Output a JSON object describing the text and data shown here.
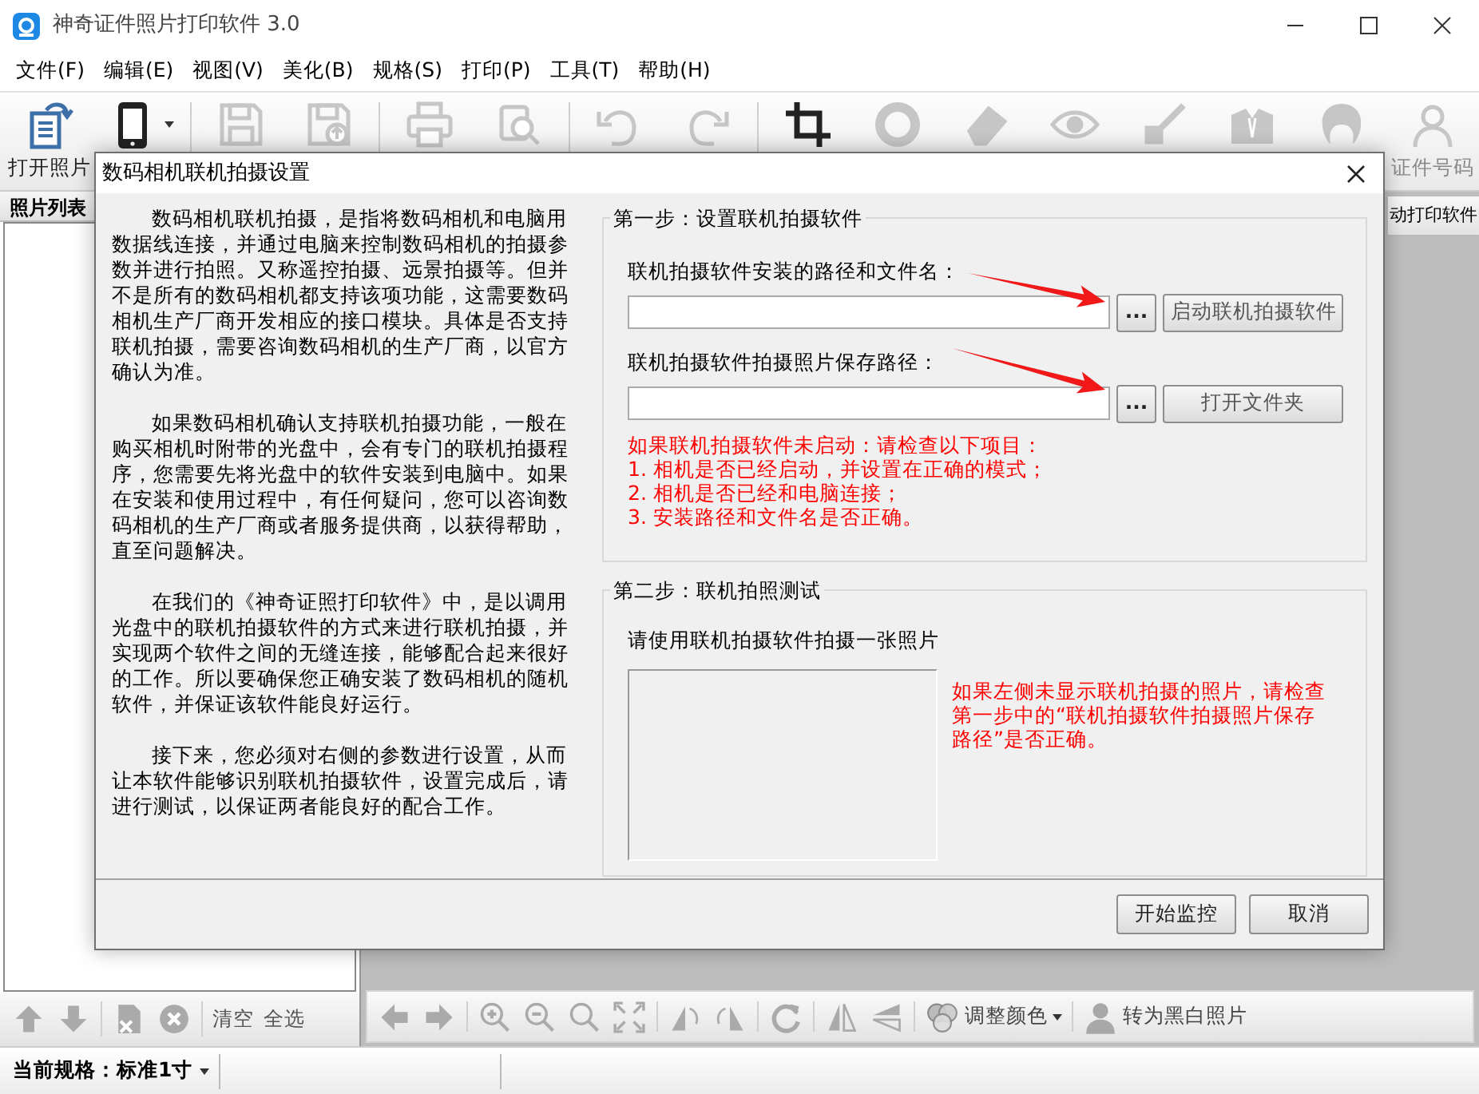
{
  "window": {
    "title": "神奇证件照片打印软件 3.0"
  },
  "menu": [
    "文件(F)",
    "编辑(E)",
    "视图(V)",
    "美化(B)",
    "规格(S)",
    "打印(P)",
    "工具(T)",
    "帮助(H)"
  ],
  "toolbar": [
    [
      {
        "label": "打开照片",
        "disabled": false,
        "dropdown": false
      },
      {
        "disabled": false,
        "dropdown": true
      }
    ],
    [
      {
        "disabled": true,
        "dropdown": false
      },
      {
        "disabled": true,
        "dropdown": false
      }
    ],
    [
      {
        "disabled": true,
        "dropdown": false
      },
      {
        "disabled": true,
        "dropdown": false
      }
    ],
    [
      {
        "disabled": true,
        "dropdown": false
      },
      {
        "disabled": true,
        "dropdown": false
      }
    ],
    [
      {
        "disabled": false,
        "dropdown": false
      },
      {
        "disabled": true,
        "dropdown": false
      },
      {
        "disabled": true,
        "dropdown": false
      },
      {
        "disabled": true,
        "dropdown": false
      },
      {
        "disabled": true,
        "dropdown": false
      },
      {
        "disabled": true,
        "dropdown": false
      },
      {
        "disabled": true,
        "dropdown": false
      },
      {
        "label": "证件号码",
        "disabled": true,
        "dropdown": false
      }
    ]
  ],
  "photo_list": {
    "header": "照片列表",
    "tools": [
      [
        {
          "disabled": true
        },
        {
          "disabled": true
        }
      ],
      [
        {
          "disabled": true
        },
        {
          "disabled": true
        }
      ],
      [
        {
          "label": "清空",
          "disabled": false
        },
        {
          "label": "全选",
          "disabled": false
        }
      ]
    ]
  },
  "side_tab": "动打印软件",
  "view_tools": [
    [
      {
        "disabled": true,
        "dropdown": false
      },
      {
        "disabled": true,
        "dropdown": false
      }
    ],
    [
      {
        "disabled": true,
        "dropdown": false
      },
      {
        "disabled": true,
        "dropdown": false
      },
      {
        "disabled": true,
        "dropdown": false
      },
      {
        "disabled": true,
        "dropdown": false
      }
    ],
    [
      {
        "disabled": true,
        "dropdown": false
      },
      {
        "disabled": true,
        "dropdown": false
      }
    ],
    [
      {
        "disabled": true,
        "dropdown": false
      }
    ],
    [
      {
        "disabled": true,
        "dropdown": false
      },
      {
        "disabled": true,
        "dropdown": false
      }
    ],
    [
      {
        "label": "调整颜色",
        "disabled": false,
        "dropdown": true
      }
    ],
    [
      {
        "label": "转为黑白照片",
        "disabled": false,
        "dropdown": false
      }
    ]
  ],
  "status_bar": {
    "spec": "当前规格：标准1寸",
    "dropdown": true
  },
  "dialog": {
    "title": "数码相机联机拍摄设置",
    "intro": [
      "数码相机联机拍摄，是指将数码相机和电脑用数据线连接，并通过电脑来控制数码相机的拍摄参数并进行拍照。又称遥控拍摄、远景拍摄等。但并不是所有的数码相机都支持该项功能，这需要数码相机生产厂商开发相应的接口模块。具体是否支持联机拍摄，需要咨询数码相机的生产厂商，以官方确认为准。",
      "如果数码相机确认支持联机拍摄功能，一般在购买相机时附带的光盘中，会有专门的联机拍摄程序，您需要先将光盘中的软件安装到电脑中。如果在安装和使用过程中，有任何疑问，您可以咨询数码相机的生产厂商或者服务提供商，以获得帮助，直至问题解决。",
      "在我们的《神奇证照打印软件》中，是以调用光盘中的联机拍摄软件的方式来进行联机拍摄，并实现两个软件之间的无缝连接，能够配合起来很好的工作。所以要确保您正确安装了数码相机的随机软件，并保证该软件能良好运行。",
      "接下来，您必须对右侧的参数进行设置，从而让本软件能够识别联机拍摄软件，设置完成后，请进行测试，以保证两者能良好的配合工作。"
    ],
    "step1": {
      "legend": "第一步：设置联机拍摄软件",
      "fields": [
        {
          "label": "联机拍摄软件安装的路径和文件名：",
          "browse": "...",
          "action": "启动联机拍摄软件"
        },
        {
          "label": "联机拍摄软件拍摄照片保存路径：",
          "browse": "...",
          "action": "打开文件夹"
        }
      ],
      "warning": [
        "如果联机拍摄软件未启动：请检查以下项目：",
        "1. 相机是否已经启动，并设置在正确的模式；",
        "2. 相机是否已经和电脑连接；",
        "3. 安装路径和文件名是否正确。"
      ]
    },
    "step2": {
      "legend": "第二步：联机拍照测试",
      "instruction": "请使用联机拍摄软件拍摄一张照片",
      "note": "如果左侧未显示联机拍摄的照片，请检查第一步中的“联机拍摄软件拍摄照片保存路径”是否正确。"
    },
    "buttons": [
      "开始监控",
      "取消"
    ]
  }
}
